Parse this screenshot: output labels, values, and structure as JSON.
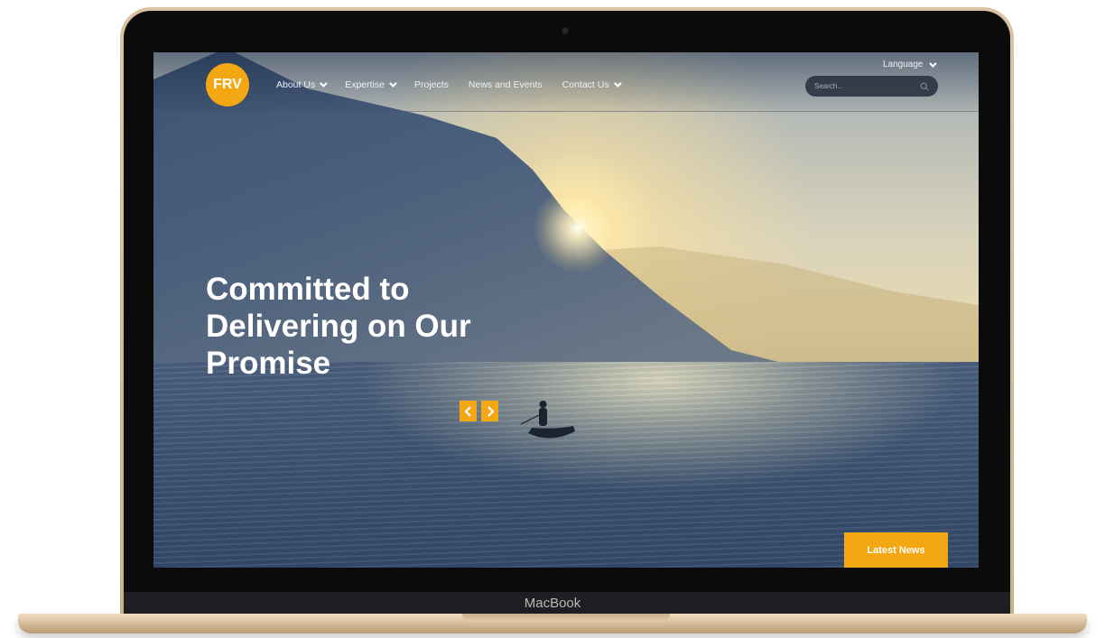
{
  "device": {
    "brand_label": "MacBook"
  },
  "site": {
    "logo_text": "FRV",
    "nav": [
      {
        "label": "About Us",
        "has_dropdown": true
      },
      {
        "label": "Expertise",
        "has_dropdown": true
      },
      {
        "label": "Projects",
        "has_dropdown": false
      },
      {
        "label": "News and Events",
        "has_dropdown": false
      },
      {
        "label": "Contact Us",
        "has_dropdown": true
      }
    ],
    "language_label": "Language",
    "search": {
      "placeholder": "Search..."
    },
    "hero": {
      "title_lines": [
        "Committed to",
        "Delivering on Our",
        "Promise"
      ]
    },
    "latest_news_label": "Latest News"
  },
  "icons": {
    "prev": "chevron-left-icon",
    "next": "chevron-right-icon",
    "search": "search-icon",
    "dropdown": "chevron-down-icon"
  },
  "colors": {
    "accent": "#f3a712",
    "text_light": "#ffffff"
  }
}
